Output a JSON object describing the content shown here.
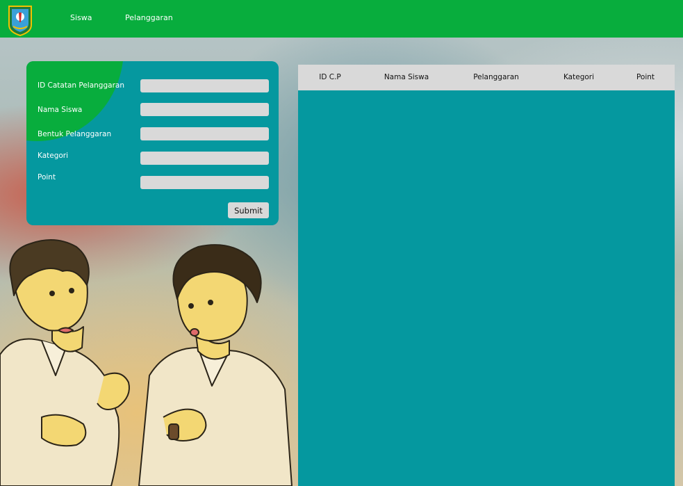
{
  "nav": {
    "logo": "regional-emblem-logo",
    "links": [
      "Siswa",
      "Pelanggaran"
    ]
  },
  "form": {
    "fields": [
      {
        "label": "ID Catatan Pelanggaran",
        "value": "",
        "placeholder": ""
      },
      {
        "label": "Nama Siswa",
        "value": "",
        "placeholder": ""
      },
      {
        "label": "Bentuk Pelanggaran",
        "value": "",
        "placeholder": ""
      },
      {
        "label": "Kategori",
        "value": "",
        "placeholder": ""
      },
      {
        "label": "Point",
        "value": "",
        "placeholder": ""
      }
    ],
    "submit_label": "Submit"
  },
  "table": {
    "columns": [
      "ID C.P",
      "Nama Siswa",
      "Pelanggaran",
      "Kategori",
      "Point"
    ],
    "rows": []
  },
  "colors": {
    "navbar": "#08ad3d",
    "panel": "#05989f",
    "input": "#d9d9d9"
  }
}
